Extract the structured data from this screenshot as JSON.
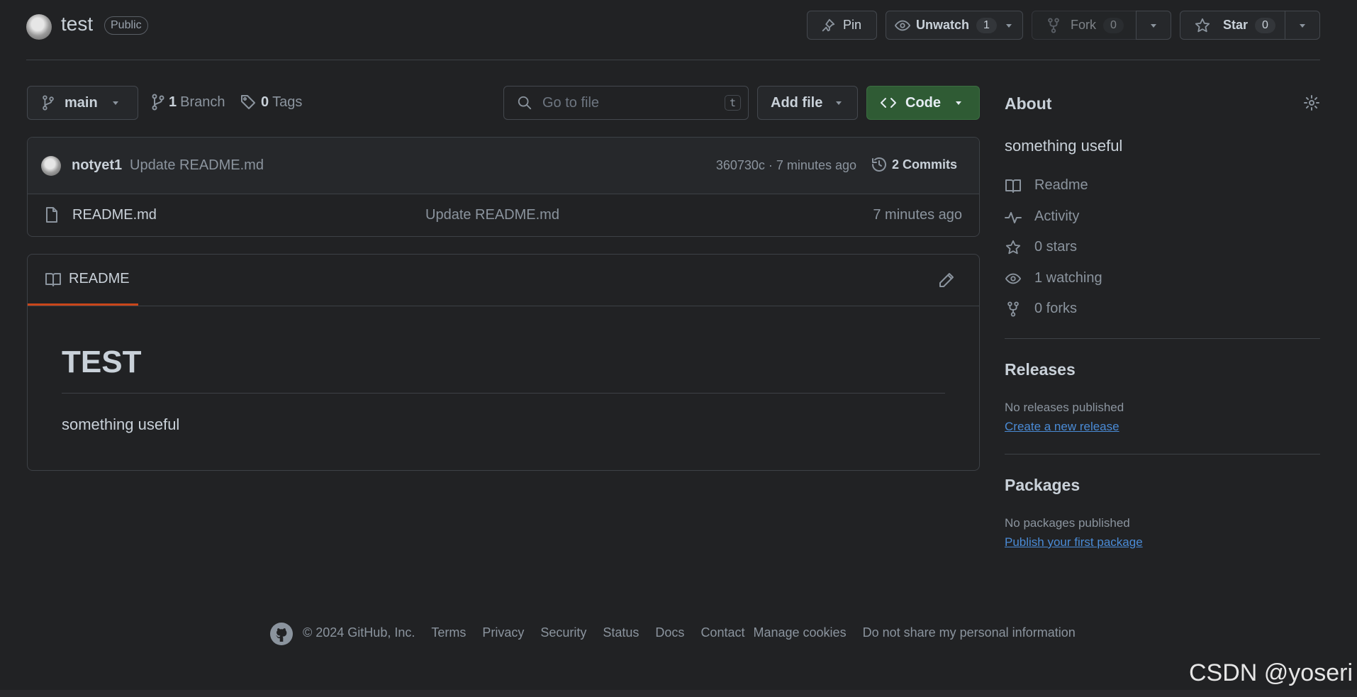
{
  "repo": {
    "name": "test",
    "visibility": "Public"
  },
  "header_actions": {
    "pin": "Pin",
    "unwatch": "Unwatch",
    "watch_count": "1",
    "fork": "Fork",
    "fork_count": "0",
    "star": "Star",
    "star_count": "0"
  },
  "toolbar": {
    "branch": "main",
    "branches_count": "1",
    "branches_label": "Branch",
    "tags_count": "0",
    "tags_label": "Tags",
    "search_placeholder": "Go to file",
    "search_shortcut": "t",
    "add_file": "Add file",
    "code": "Code"
  },
  "latest_commit": {
    "author": "notyet1",
    "message": "Update README.md",
    "meta": "360730c · 7 minutes ago",
    "commits": "2 Commits"
  },
  "files": [
    {
      "name": "README.md",
      "message": "Update README.md",
      "time": "7 minutes ago"
    }
  ],
  "readme": {
    "tab": "README",
    "heading": "TEST",
    "body": "something useful"
  },
  "about": {
    "title": "About",
    "description": "something useful",
    "items": [
      {
        "icon": "book-icon",
        "label": "Readme"
      },
      {
        "icon": "pulse-icon",
        "label": "Activity"
      },
      {
        "icon": "star-icon",
        "label": "0 stars"
      },
      {
        "icon": "eye-icon",
        "label": "1 watching"
      },
      {
        "icon": "fork-icon",
        "label": "0 forks"
      }
    ]
  },
  "releases": {
    "title": "Releases",
    "empty": "No releases published",
    "link": "Create a new release"
  },
  "packages": {
    "title": "Packages",
    "empty": "No packages published",
    "link": "Publish your first package"
  },
  "footer": {
    "copyright": "© 2024 GitHub, Inc.",
    "links": [
      "Terms",
      "Privacy",
      "Security",
      "Status",
      "Docs",
      "Contact",
      "Manage cookies",
      "Do not share my personal information"
    ]
  },
  "watermark": "CSDN @yoseri",
  "colors": {
    "background": "#212224",
    "code_button": "#2f5b34",
    "link": "#4a8bd6",
    "tab_underline": "#c9461a"
  }
}
